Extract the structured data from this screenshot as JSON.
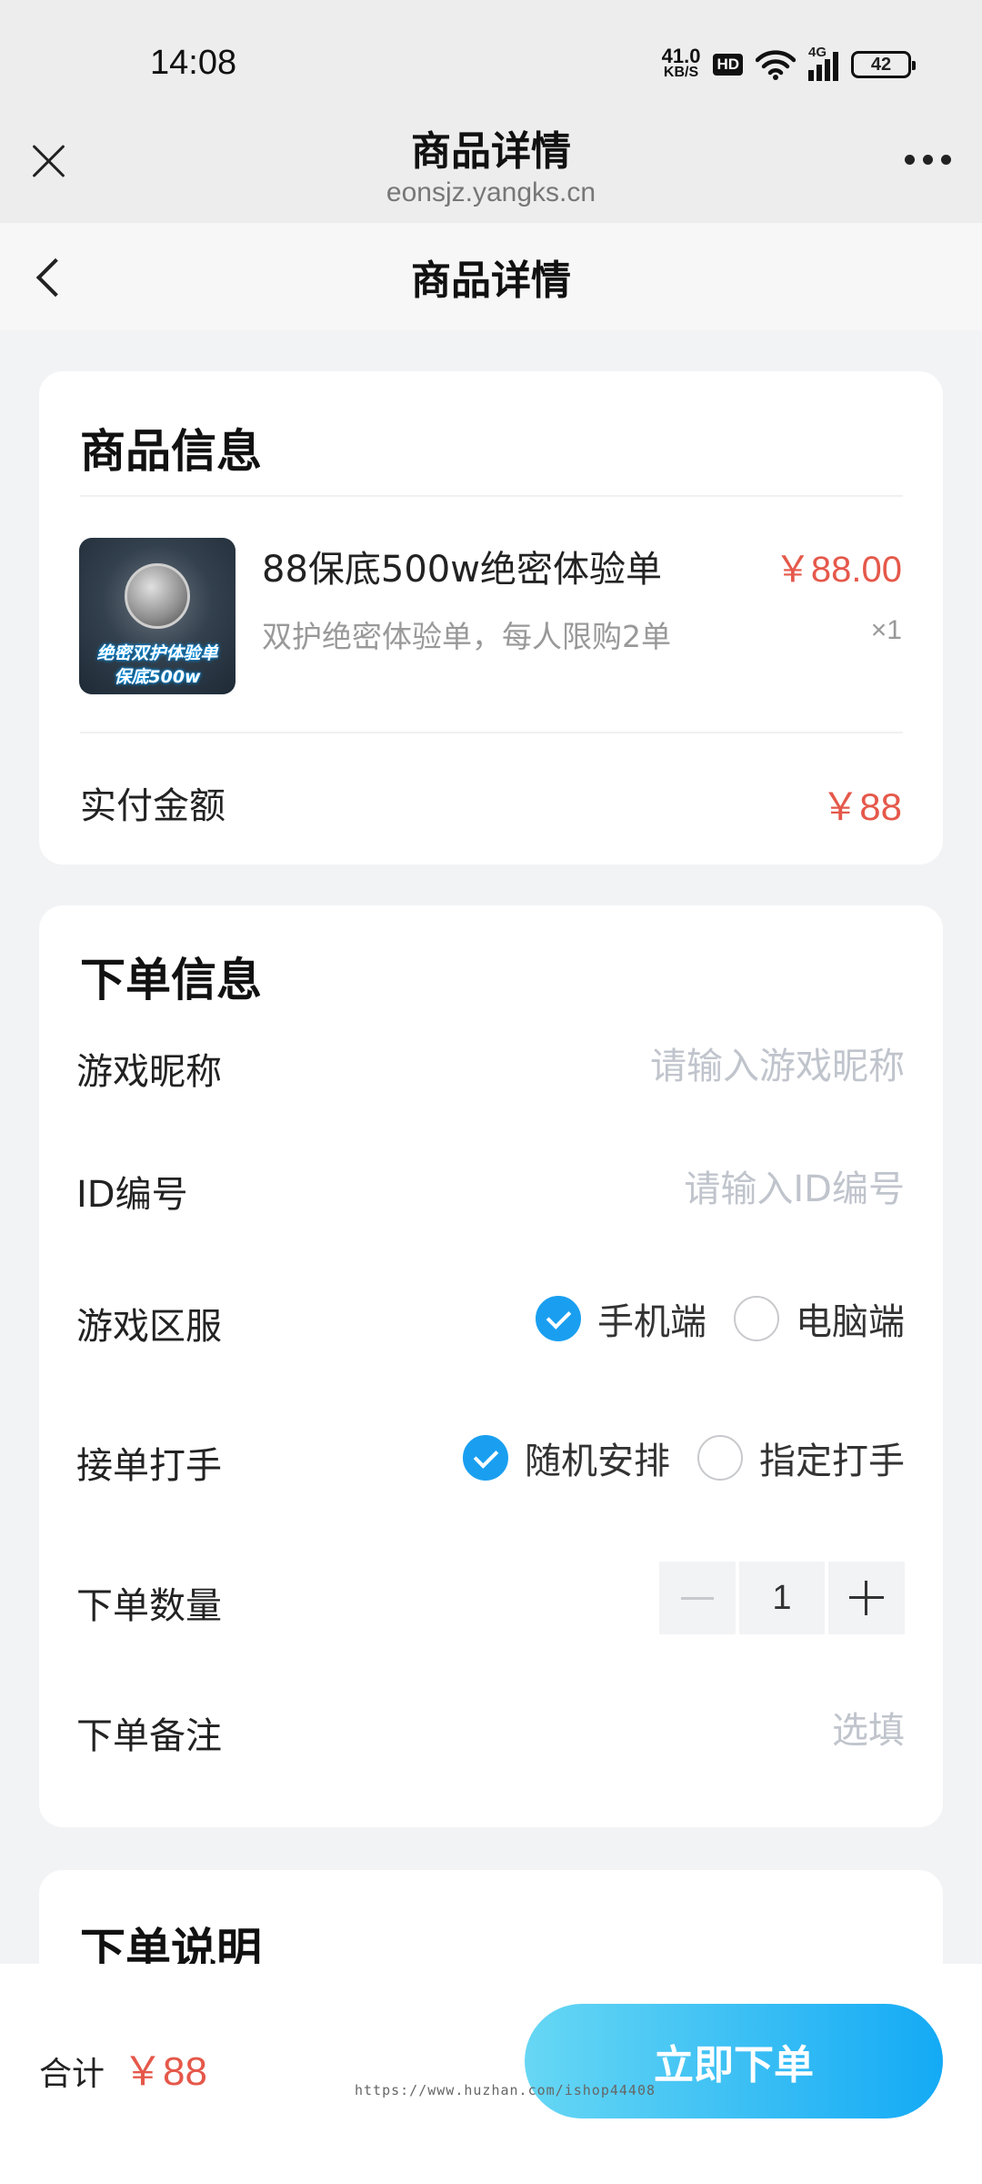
{
  "status_bar": {
    "time": "14:08",
    "net_speed_value": "41.0",
    "net_speed_unit": "KB/S",
    "hd_badge": "HD",
    "signal_label": "4G",
    "battery": "42"
  },
  "browser": {
    "title": "商品详情",
    "url": "eonsjz.yangks.cn"
  },
  "page": {
    "title": "商品详情"
  },
  "product_card": {
    "title": "商品信息",
    "thumb_text_line1": "绝密双护体验单",
    "thumb_text_line2": "保底500w",
    "name": "88保底500w绝密体验单",
    "price": "￥88.00",
    "description": "双护绝密体验单，每人限购2单",
    "quantity": "×1",
    "pay_label": "实付金额",
    "pay_value": "￥88"
  },
  "order_card": {
    "title": "下单信息",
    "nickname_label": "游戏昵称",
    "nickname_placeholder": "请输入游戏昵称",
    "id_label": "ID编号",
    "id_placeholder": "请输入ID编号",
    "server_label": "游戏区服",
    "server_options": [
      "手机端",
      "电脑端"
    ],
    "server_selected": "手机端",
    "booster_label": "接单打手",
    "booster_options": [
      "随机安排",
      "指定打手"
    ],
    "booster_selected": "随机安排",
    "qty_label": "下单数量",
    "qty_value": "1",
    "note_label": "下单备注",
    "note_placeholder": "选填"
  },
  "instructions_card": {
    "title": "下单说明"
  },
  "bottom_bar": {
    "total_label": "合计",
    "total_value": "￥88",
    "order_button": "立即下单",
    "watermark": "https://www.huzhan.com/ishop44408"
  }
}
